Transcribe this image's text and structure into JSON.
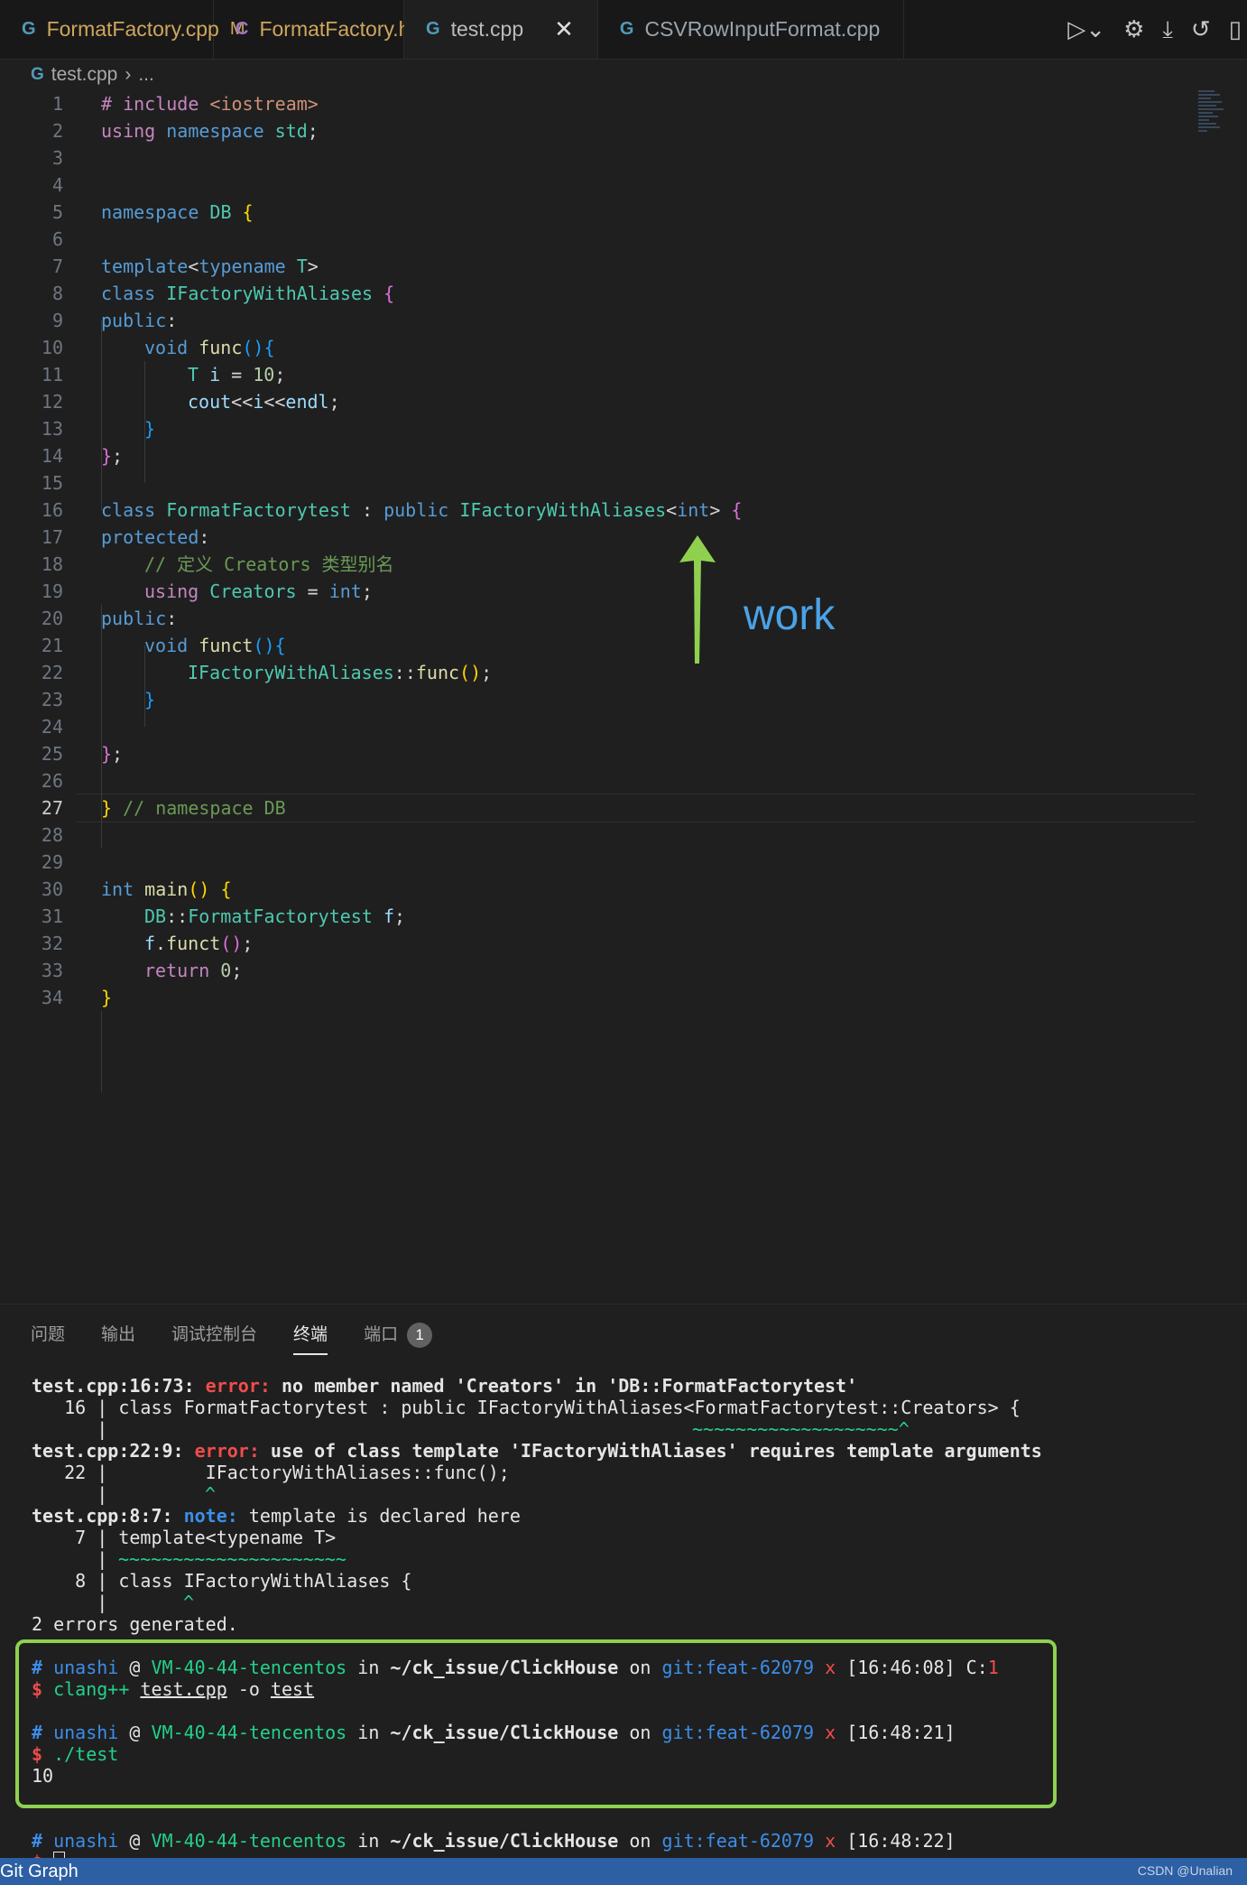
{
  "tabs": [
    {
      "label": "FormatFactory.cpp",
      "icon": "cpp-file-icon",
      "modified": "M"
    },
    {
      "label": "FormatFactory.h",
      "icon": "h-file-icon",
      "modified": "M"
    },
    {
      "label": "test.cpp",
      "icon": "cpp-file-icon",
      "close": "✕"
    },
    {
      "label": "CSVRowInputFormat.cpp",
      "icon": "cpp-file-icon"
    }
  ],
  "breadcrumb": {
    "file": "test.cpp",
    "rest": "..."
  },
  "line_numbers": [
    "1",
    "2",
    "3",
    "4",
    "5",
    "6",
    "7",
    "8",
    "9",
    "10",
    "11",
    "12",
    "13",
    "14",
    "15",
    "16",
    "17",
    "18",
    "19",
    "20",
    "21",
    "22",
    "23",
    "24",
    "25",
    "26",
    "27",
    "28",
    "29",
    "30",
    "31",
    "32",
    "33",
    "34"
  ],
  "code": {
    "l1": {
      "a": "# include ",
      "b": "<iostream>"
    },
    "l2": {
      "a": "using ",
      "b": "namespace ",
      "c": "std",
      "d": ";"
    },
    "l5": {
      "a": "namespace ",
      "b": "DB ",
      "c": "{"
    },
    "l7": {
      "a": "template",
      "b": "<",
      "c": "typename ",
      "d": "T",
      "e": ">"
    },
    "l8": {
      "a": "class ",
      "b": "IFactoryWithAliases ",
      "c": "{"
    },
    "l9": {
      "a": "public",
      "b": ":"
    },
    "l10": {
      "a": "void ",
      "b": "func",
      "c": "()",
      "d": "{"
    },
    "l11": {
      "a": "T ",
      "b": "i",
      "c": " = ",
      "d": "10",
      "e": ";"
    },
    "l12": {
      "a": "cout",
      "b": "<<",
      "c": "i",
      "d": "<<",
      "e": "endl",
      "f": ";"
    },
    "l13": {
      "a": "}"
    },
    "l14": {
      "a": "}",
      "b": ";"
    },
    "l16": {
      "a": "class ",
      "b": "FormatFactorytest",
      "c": " : ",
      "d": "public ",
      "e": "IFactoryWithAliases",
      "f": "<",
      "g": "int",
      "h": "> ",
      "i": "{"
    },
    "l17": {
      "a": "protected",
      "b": ":"
    },
    "l18": {
      "a": "// 定义 Creators 类型别名"
    },
    "l19": {
      "a": "using ",
      "b": "Creators",
      "c": " = ",
      "d": "int",
      "e": ";"
    },
    "l20": {
      "a": "public",
      "b": ":"
    },
    "l21": {
      "a": "void ",
      "b": "funct",
      "c": "()",
      "d": "{"
    },
    "l22": {
      "a": "IFactoryWithAliases",
      "b": "::",
      "c": "func",
      "d": "()",
      "e": ";"
    },
    "l23": {
      "a": "}"
    },
    "l25": {
      "a": "}",
      "b": ";"
    },
    "l27": {
      "a": "}",
      "b": " // namespace DB"
    },
    "l30": {
      "a": "int ",
      "b": "main",
      "c": "() ",
      "d": "{"
    },
    "l31": {
      "a": "DB",
      "b": "::",
      "c": "FormatFactorytest ",
      "d": "f",
      "e": ";"
    },
    "l32": {
      "a": "f",
      "b": ".",
      "c": "funct",
      "d": "()",
      "e": ";"
    },
    "l33": {
      "a": "return ",
      "b": "0",
      "c": ";"
    },
    "l34": {
      "a": "}"
    }
  },
  "annotation": {
    "text": "work",
    "color": "#8fd14f"
  },
  "panel": {
    "tabs": [
      "问题",
      "输出",
      "调试控制台",
      "终端",
      "端口"
    ],
    "active_tab": "终端",
    "ports_badge": "1"
  },
  "terminal": {
    "e1_loc": "test.cpp:16:73:",
    "e1_kind": "error:",
    "e1_msg": "no member named 'Creators' in 'DB::FormatFactorytest'",
    "e1_src": "   16 | class FormatFactorytest : public IFactoryWithAliases<FormatFactorytest::Creators> {",
    "e1_bar": "      |",
    "e1_squig": "~~~~~~~~~~~~~~~~~~~^",
    "e2_loc": "test.cpp:22:9:",
    "e2_kind": "error:",
    "e2_msg": "use of class template 'IFactoryWithAliases' requires template arguments",
    "e2_src": "   22 |         IFactoryWithAliases::func();",
    "e2_bar": "      |",
    "e2_caret": "^",
    "n1_loc": "test.cpp:8:7:",
    "n1_kind": "note:",
    "n1_msg": "template is declared here",
    "n1_src1": "    7 | template<typename T>",
    "n1_bar1": "      |",
    "n1_squig": "~~~~~~~~~~~~~~~~~~~~~",
    "n1_src2": "    8 | class IFactoryWithAliases {",
    "n1_bar2": "      |",
    "n1_caret": "^",
    "summary": "2 errors generated.",
    "prompts": [
      {
        "user": "unashi",
        "host": "VM-40-44-tencentos",
        "path": "~/ck_issue/ClickHouse",
        "branch": "git:feat-62079",
        "mark": "x",
        "time": "[16:46:08]",
        "code_label": "C:",
        "code_val": "1"
      },
      {
        "user": "unashi",
        "host": "VM-40-44-tencentos",
        "path": "~/ck_issue/ClickHouse",
        "branch": "git:feat-62079",
        "mark": "x",
        "time": "[16:48:21]"
      },
      {
        "user": "unashi",
        "host": "VM-40-44-tencentos",
        "path": "~/ck_issue/ClickHouse",
        "branch": "git:feat-62079",
        "mark": "x",
        "time": "[16:48:22]"
      }
    ],
    "cmd1": {
      "bin": "clang++",
      "arg1": "test.cpp",
      "flag": "-o",
      "arg2": "test"
    },
    "cmd2": "./test",
    "output": "10",
    "at": "@",
    "in": "in",
    "on": "on",
    "hash": "#",
    "dollar": "$"
  },
  "statusbar": {
    "git": "Git Graph",
    "watermark": "CSDN @Unalian",
    "bg": "#2c5fa3"
  }
}
